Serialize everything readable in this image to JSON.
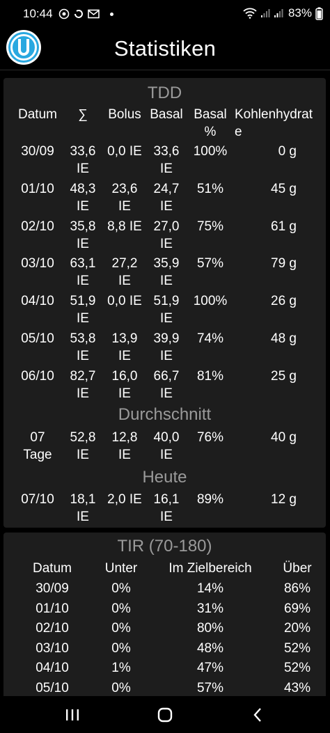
{
  "status_bar": {
    "time": "10:44",
    "battery": "83%"
  },
  "app_bar": {
    "title": "Statistiken"
  },
  "tdd": {
    "title": "TDD",
    "headers": {
      "date": "Datum",
      "sum": "∑",
      "bolus": "Bolus",
      "basal": "Basal",
      "basal_pct_line1": "Basal",
      "basal_pct_line2": "%",
      "carbs_line1": "Kohlenhydrat",
      "carbs_line2": "e"
    },
    "rows": [
      {
        "date": "30/09",
        "sum": "33,6",
        "sum_unit": "IE",
        "bolus": "0,0 IE",
        "bolus_unit": "",
        "basal": "33,6",
        "basal_unit": "IE",
        "pct": "100%",
        "carbs": "0 g"
      },
      {
        "date": "01/10",
        "sum": "48,3",
        "sum_unit": "IE",
        "bolus": "23,6",
        "bolus_unit": "IE",
        "basal": "24,7",
        "basal_unit": "IE",
        "pct": "51%",
        "carbs": "45 g"
      },
      {
        "date": "02/10",
        "sum": "35,8",
        "sum_unit": "IE",
        "bolus": "8,8 IE",
        "bolus_unit": "",
        "basal": "27,0",
        "basal_unit": "IE",
        "pct": "75%",
        "carbs": "61 g"
      },
      {
        "date": "03/10",
        "sum": "63,1",
        "sum_unit": "IE",
        "bolus": "27,2",
        "bolus_unit": "IE",
        "basal": "35,9",
        "basal_unit": "IE",
        "pct": "57%",
        "carbs": "79 g"
      },
      {
        "date": "04/10",
        "sum": "51,9",
        "sum_unit": "IE",
        "bolus": "0,0 IE",
        "bolus_unit": "",
        "basal": "51,9",
        "basal_unit": "IE",
        "pct": "100%",
        "carbs": "26 g"
      },
      {
        "date": "05/10",
        "sum": "53,8",
        "sum_unit": "IE",
        "bolus": "13,9",
        "bolus_unit": "IE",
        "basal": "39,9",
        "basal_unit": "IE",
        "pct": "74%",
        "carbs": "48 g"
      },
      {
        "date": "06/10",
        "sum": "82,7",
        "sum_unit": "IE",
        "bolus": "16,0",
        "bolus_unit": "IE",
        "basal": "66,7",
        "basal_unit": "IE",
        "pct": "81%",
        "carbs": "25 g"
      }
    ],
    "average": {
      "title": "Durchschnitt",
      "row": {
        "date": "07",
        "date_line2": "Tage",
        "sum": "52,8",
        "sum_unit": "IE",
        "bolus": "12,8",
        "bolus_unit": "IE",
        "basal": "40,0",
        "basal_unit": "IE",
        "pct": "76%",
        "carbs": "40 g"
      }
    },
    "today": {
      "title": "Heute",
      "row": {
        "date": "07/10",
        "sum": "18,1",
        "sum_unit": "IE",
        "bolus": "2,0 IE",
        "bolus_unit": "",
        "basal": "16,1",
        "basal_unit": "IE",
        "pct": "89%",
        "carbs": "12 g"
      }
    }
  },
  "tir": {
    "title": "TIR (70-180)",
    "headers": {
      "date": "Datum",
      "below": "Unter",
      "in_range": "Im Zielbereich",
      "above": "Über"
    },
    "rows": [
      {
        "date": "30/09",
        "below": "0%",
        "in_range": "14%",
        "above": "86%"
      },
      {
        "date": "01/10",
        "below": "0%",
        "in_range": "31%",
        "above": "69%"
      },
      {
        "date": "02/10",
        "below": "0%",
        "in_range": "80%",
        "above": "20%"
      },
      {
        "date": "03/10",
        "below": "0%",
        "in_range": "48%",
        "above": "52%"
      },
      {
        "date": "04/10",
        "below": "1%",
        "in_range": "47%",
        "above": "52%"
      },
      {
        "date": "05/10",
        "below": "0%",
        "in_range": "57%",
        "above": "43%"
      }
    ]
  },
  "colors": {
    "background": "#000000",
    "card": "#1d1d1d",
    "section_title": "#9a9a9a",
    "logo_blue": "#29a8e0"
  },
  "icons": {
    "status_left": [
      "assistant-icon",
      "sync-circle-icon",
      "mail-icon"
    ],
    "status_right": [
      "wifi-icon",
      "signal-icon",
      "signal-icon",
      "battery-icon"
    ],
    "nav": [
      "recents-icon",
      "home-icon",
      "back-icon"
    ]
  }
}
